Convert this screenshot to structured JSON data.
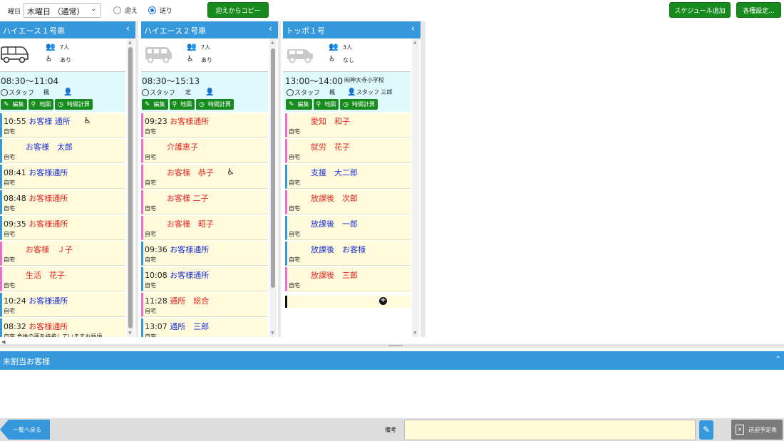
{
  "toolbar": {
    "day_label": "曜日",
    "day_value": "木曜日 （通常）",
    "radio_pickup": "迎え",
    "radio_dropoff": "送り",
    "copy_button": "迎えからコピー",
    "add_schedule_button": "スケジュール追加",
    "settings_button": "各種設定..."
  },
  "columns": [
    {
      "title": "ハイエース１号車",
      "capacity": "7人",
      "wheelchair": "あり",
      "time": "08:30～11:04",
      "destination": "",
      "staff_label": "スタッフ",
      "staff1": "楓",
      "staff2": "",
      "buttons": {
        "edit": "編集",
        "map": "地図",
        "calc": "時間計算"
      },
      "cards": [
        {
          "time": "10:55",
          "name": "お客様 通所",
          "color": "blue",
          "home": "自宅",
          "wc": true,
          "stripe": "blue"
        },
        {
          "time": "",
          "name": "お客様　太郎",
          "color": "blue",
          "home": "自宅",
          "wc": false,
          "stripe": "blue"
        },
        {
          "time": "08:41",
          "name": "お客様通所",
          "color": "blue",
          "home": "自宅",
          "wc": false,
          "stripe": "blue"
        },
        {
          "time": "08:48",
          "name": "お客様通所",
          "color": "red",
          "home": "自宅",
          "wc": false,
          "stripe": "blue"
        },
        {
          "time": "09:35",
          "name": "お客様通所",
          "color": "red",
          "home": "自宅",
          "wc": false,
          "stripe": "blue"
        },
        {
          "time": "",
          "name": "お客様　Ｊ子",
          "color": "red",
          "home": "自宅",
          "wc": false,
          "stripe": "pink"
        },
        {
          "time": "",
          "name": "生活　花子",
          "color": "red",
          "home": "自宅",
          "wc": false,
          "stripe": "pink"
        },
        {
          "time": "10:24",
          "name": "お客様通所",
          "color": "blue",
          "home": "自宅",
          "wc": false,
          "stripe": "blue"
        },
        {
          "time": "08:32",
          "name": "お客様通所",
          "color": "red",
          "home": "自宅 食後の薬を持参していますお昼頃",
          "wc": false,
          "stripe": "blue"
        }
      ]
    },
    {
      "title": "ハイエース２号車",
      "capacity": "7人",
      "wheelchair": "あり",
      "time": "08:30～15:13",
      "destination": "",
      "staff_label": "スタッフ",
      "staff1": "定",
      "staff2": "",
      "buttons": {
        "edit": "編集",
        "map": "地図",
        "calc": "時間計算"
      },
      "cards": [
        {
          "time": "09:23",
          "name": "お客様通所",
          "color": "red",
          "home": "自宅",
          "wc": false,
          "stripe": "pink"
        },
        {
          "time": "",
          "name": "介護恵子",
          "color": "red",
          "home": "自宅",
          "wc": false,
          "stripe": "pink"
        },
        {
          "time": "",
          "name": "お客様　恭子",
          "color": "red",
          "home": "自宅",
          "wc": true,
          "stripe": "pink"
        },
        {
          "time": "",
          "name": "お客様 二子",
          "color": "red",
          "home": "自宅",
          "wc": false,
          "stripe": "pink"
        },
        {
          "time": "",
          "name": "お客様　昭子",
          "color": "red",
          "home": "自宅",
          "wc": false,
          "stripe": "pink"
        },
        {
          "time": "09:36",
          "name": "お客様通所",
          "color": "blue",
          "home": "自宅",
          "wc": false,
          "stripe": "blue"
        },
        {
          "time": "10:08",
          "name": "お客様通所",
          "color": "blue",
          "home": "自宅",
          "wc": false,
          "stripe": "blue"
        },
        {
          "time": "11:28",
          "name": "通所　総合",
          "color": "red",
          "home": "自宅",
          "wc": false,
          "stripe": "pink"
        },
        {
          "time": "13:07",
          "name": "通所　三郎",
          "color": "blue",
          "home": "自宅",
          "wc": false,
          "stripe": "blue"
        }
      ]
    },
    {
      "title": "トッポ１号",
      "capacity": "3人",
      "wheelchair": "なし",
      "time": "13:00～14:00",
      "destination": "㈲神大寺小学校",
      "staff_label": "スタッフ",
      "staff1": "楓",
      "staff2": "スタッフ 三郎",
      "buttons": {
        "edit": "編集",
        "map": "地図",
        "calc": "時間計算"
      },
      "cards": [
        {
          "time": "",
          "name": "愛知　和子",
          "color": "red",
          "home": "自宅",
          "wc": false,
          "stripe": "pink"
        },
        {
          "time": "",
          "name": "就労　花子",
          "color": "red",
          "home": "自宅",
          "wc": false,
          "stripe": "pink"
        },
        {
          "time": "",
          "name": "支援　大二郎",
          "color": "blue",
          "home": "自宅",
          "wc": false,
          "stripe": "blue"
        },
        {
          "time": "",
          "name": "放課後　次郎",
          "color": "red",
          "home": "自宅",
          "wc": false,
          "stripe": "pink"
        },
        {
          "time": "",
          "name": "放課後　一郎",
          "color": "blue",
          "home": "自宅",
          "wc": false,
          "stripe": "blue"
        },
        {
          "time": "",
          "name": "放課後　お客様",
          "color": "blue",
          "home": "自宅",
          "wc": false,
          "stripe": "blue"
        },
        {
          "time": "",
          "name": "放課後　三郎",
          "color": "red",
          "home": "自宅",
          "wc": false,
          "stripe": "pink"
        }
      ]
    }
  ],
  "unassigned": {
    "title": "未割当お客様"
  },
  "footer": {
    "back_button": "一覧へ戻る",
    "memo_label": "備考",
    "memo_value": "",
    "schedule_table_button": "送迎予定表"
  },
  "colors": {
    "green": "#188b1e",
    "blue_header": "#3598db",
    "card_bg": "#fffbdc",
    "schedule_bg": "#dffafd",
    "red_text": "#e8231f",
    "blue_text": "#1a2fd8",
    "pink_stripe": "#f06ad1"
  },
  "icons": {
    "capacity": "people-icon",
    "wheelchair": "wheelchair-icon",
    "staff": "steering-wheel-icon",
    "edit": "pencil-icon",
    "map": "map-pin-icon",
    "calc": "clock-icon"
  }
}
